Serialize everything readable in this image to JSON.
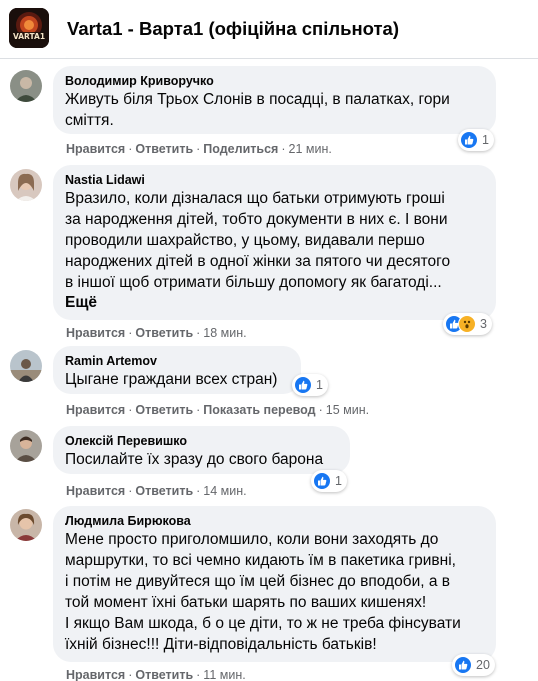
{
  "group": {
    "logo_text": "VARTA1",
    "title": "Varta1 - Варта1 (офіційна спільнота)"
  },
  "comments": [
    {
      "author": "Володимир Криворучко",
      "text": "Живуть біля Трьох Слонів в посадці, в палатках, гори\nсміття.",
      "more": "",
      "reactions": {
        "types": [
          "like"
        ],
        "count": "1"
      },
      "actions": [
        "Нравится",
        "Ответить",
        "Поделиться"
      ],
      "time": "21 мин."
    },
    {
      "author": "Nastia Lidawi",
      "text": "Вразило, коли дізналася що батьки отримують гроші\nза народження дітей, тобто документи в них є. І вони\nпроводили шахрайство, у цьому, видавали першо\nнароджених дітей в одної жінки за пятого чи десятого\nв іншої щоб отримати більшу допомогу як багатоді...",
      "more": "Ещё",
      "reactions": {
        "types": [
          "like",
          "wow"
        ],
        "count": "3"
      },
      "actions": [
        "Нравится",
        "Ответить"
      ],
      "time": "18 мин."
    },
    {
      "author": "Ramin Artemov",
      "text": "Цыгане граждани всех стран)",
      "more": "",
      "reactions": {
        "types": [
          "like"
        ],
        "count": "1"
      },
      "actions": [
        "Нравится",
        "Ответить",
        "Показать перевод"
      ],
      "time": "15 мин."
    },
    {
      "author": "Олексій Перевишко",
      "text": "Посилайте їх зразу до свого барона",
      "more": "",
      "reactions": {
        "types": [
          "like"
        ],
        "count": "1"
      },
      "actions": [
        "Нравится",
        "Ответить"
      ],
      "time": "14 мин."
    },
    {
      "author": "Людмила Бирюкова",
      "text": "Мене просто приголомшило, коли вони заходять до\nмаршрутки, то всі чемно кидають їм в пакетика гривні,\nі потім не дивуйтеся що їм цей бізнес до вподоби, а в\nтой момент їхні батьки шарять по ваших кишенях!\nІ якщо Вам шкода, б о це діти, то ж не треба фінсувати\nїхній бізнес!!! Діти-відповідальність батьків!",
      "more": "",
      "reactions": {
        "types": [
          "like"
        ],
        "count": "20"
      },
      "actions": [
        "Нравится",
        "Ответить"
      ],
      "time": "11 мин."
    }
  ],
  "colors": {
    "bubble": "#f0f2f5",
    "secondary_text": "#65676b",
    "like_blue": "#1877f2",
    "wow_yellow": "#f7b125"
  }
}
